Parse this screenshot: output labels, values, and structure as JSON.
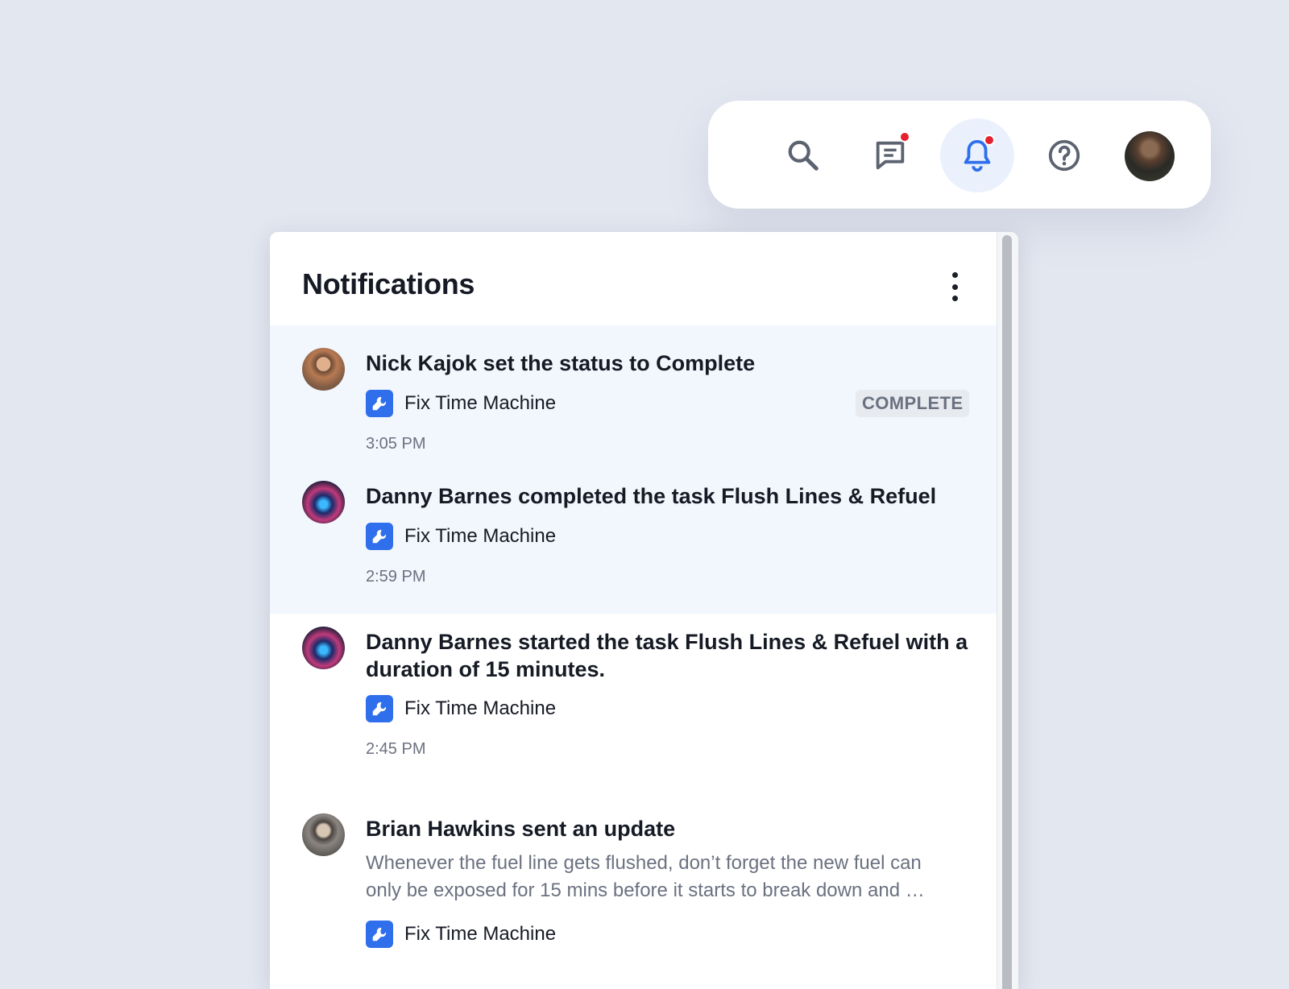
{
  "toolbar": {
    "icons": [
      "search-icon",
      "chat-icon",
      "bell-icon",
      "help-icon",
      "avatar"
    ],
    "active": "bell-icon",
    "accent": "#2f6fec",
    "badge_color": "#e5212f"
  },
  "panel": {
    "title": "Notifications",
    "menu_icon": "more-vertical-icon"
  },
  "notifications": [
    {
      "title": "Nick Kajok set the status to Complete",
      "project": "Fix Time Machine",
      "status": "COMPLETE",
      "time": "3:05 PM",
      "unread": true
    },
    {
      "title": "Danny Barnes completed the task Flush Lines & Refuel",
      "project": "Fix Time Machine",
      "time": "2:59 PM",
      "unread": true
    },
    {
      "title": "Danny Barnes started the task Flush Lines & Refuel with a duration of 15 minutes.",
      "project": "Fix Time Machine",
      "time": "2:45 PM",
      "unread": false
    },
    {
      "title": "Brian Hawkins sent an update",
      "body": "Whenever the fuel line gets flushed, don’t forget the new fuel can only be exposed for 15 mins before it starts to break down and …",
      "project": "Fix Time Machine",
      "unread": false
    }
  ]
}
